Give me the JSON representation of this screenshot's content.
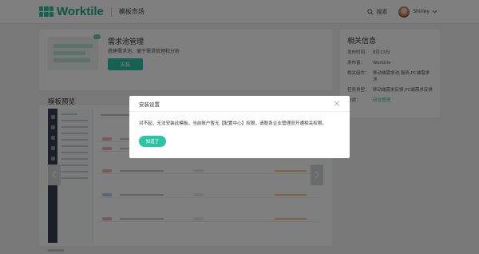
{
  "header": {
    "logo_text": "Worktile",
    "section_title": "模板市场",
    "search_label": "搜索",
    "user_name": "Shirley",
    "brand_color": "#2cc4a5"
  },
  "template": {
    "name": "需求池管理",
    "description": "搭建需求池，便于需求梳理和分析",
    "install_label": "安装"
  },
  "info": {
    "title": "相关信息",
    "rows": [
      {
        "label": "发布时间：",
        "value": "8月13日"
      },
      {
        "label": "发布者：",
        "value": "Worktile"
      },
      {
        "label": "相关组件：",
        "value": "移动端需求池,报表,PC端需求池"
      },
      {
        "label": "任务类型：",
        "value": "移动端需求反馈,PC端需求反馈"
      },
      {
        "label": "分类：",
        "value": "研发管理"
      }
    ]
  },
  "preview": {
    "title": "模板预览"
  },
  "dialog": {
    "title": "安装设置",
    "message": "对不起，无法安装此模板，当前账户暂无【配置中心】权限，请联系企业管理员开通相关权限。",
    "ok_label": "知道了"
  }
}
